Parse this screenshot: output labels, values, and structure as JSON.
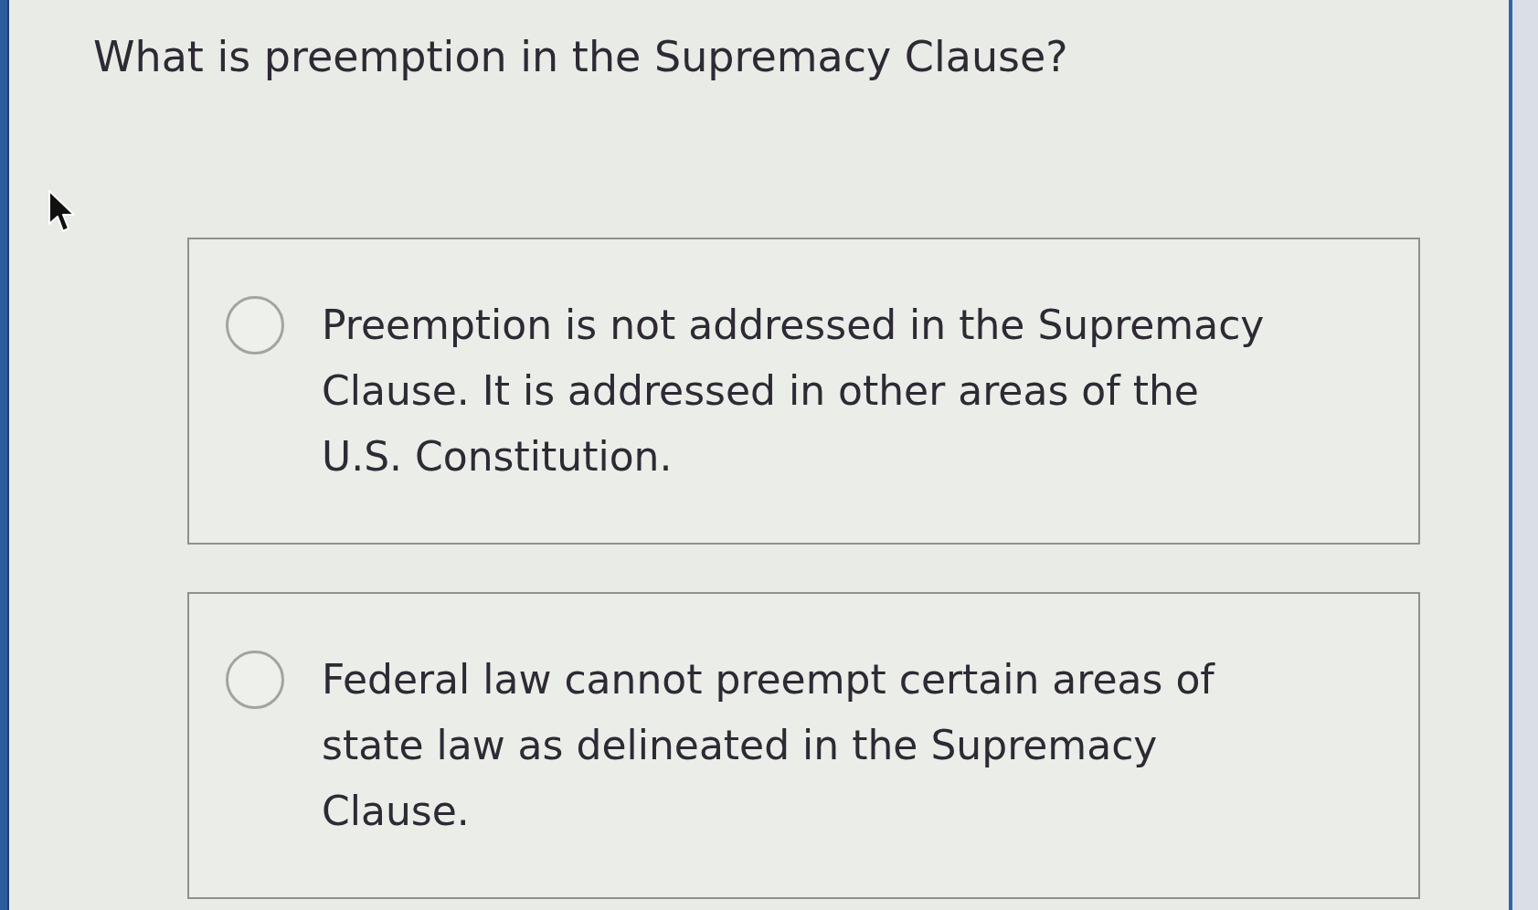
{
  "question": "What is preemption in the Supremacy Clause?",
  "options": [
    {
      "text": "Preemption is not addressed in the Supremacy Clause. It is addressed in other areas of the U.S. Constitution.",
      "selected": false
    },
    {
      "text": "Federal law cannot preempt certain areas of state law as delineated in the Supremacy Clause.",
      "selected": false
    }
  ]
}
